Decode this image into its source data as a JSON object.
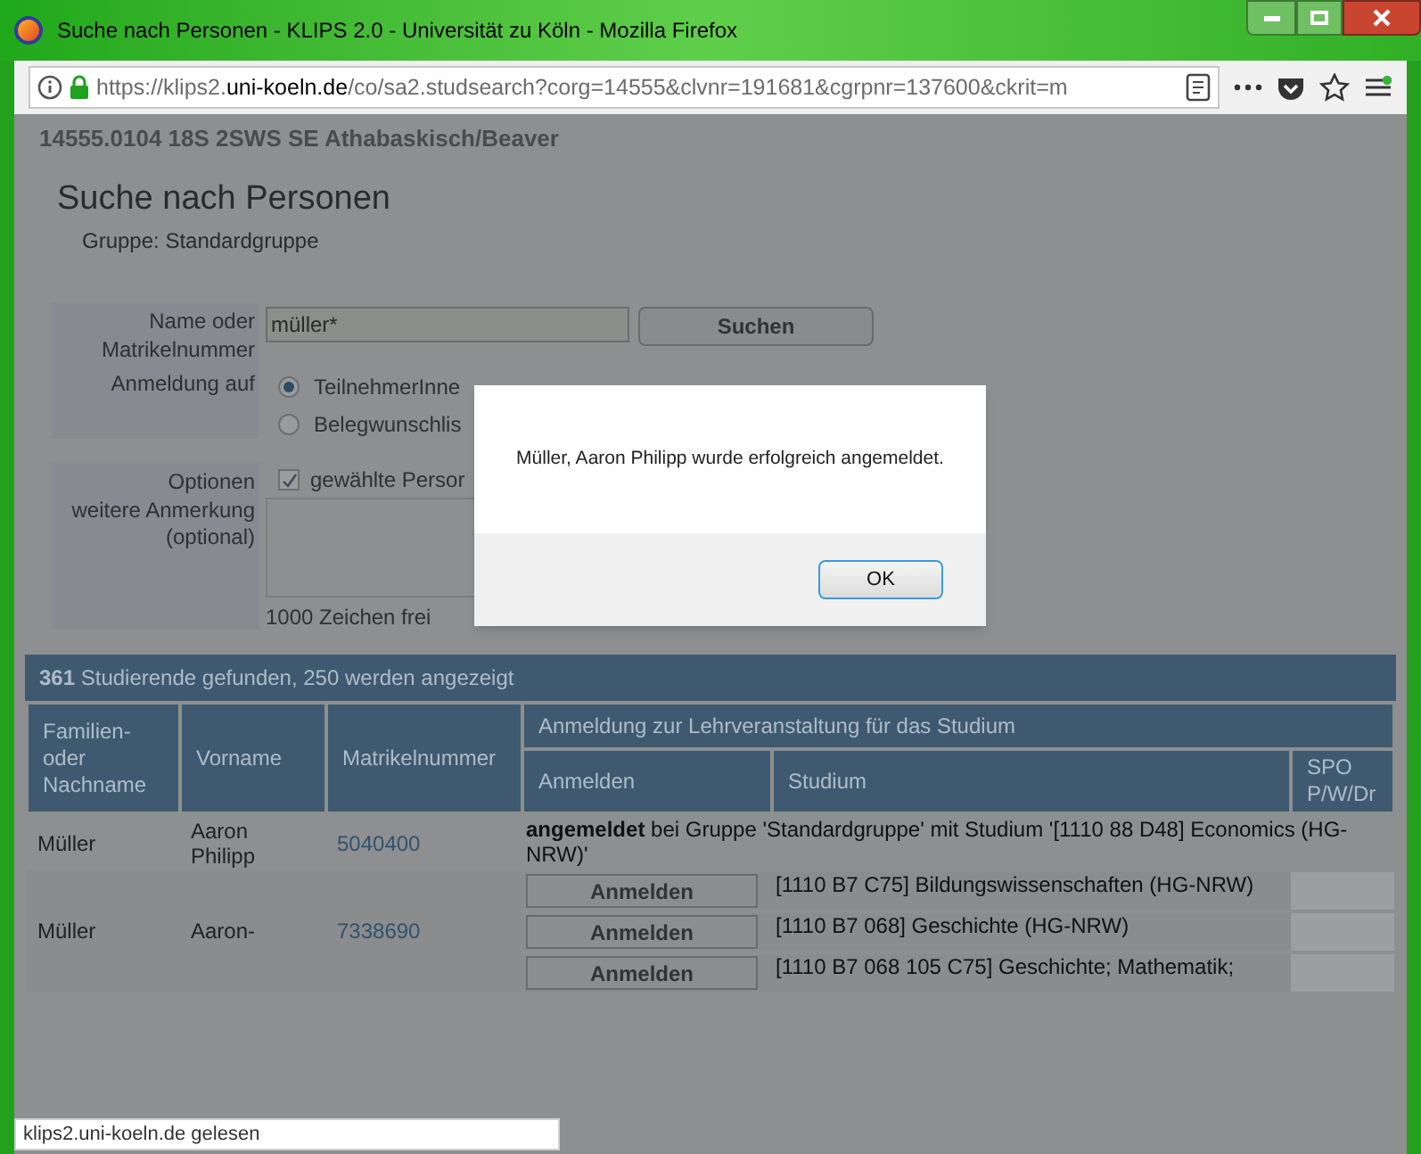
{
  "window": {
    "title": "Suche nach Personen - KLIPS 2.0 - Universität zu Köln - Mozilla Firefox"
  },
  "address_bar": {
    "url": "https://klips2.**uni-koeln.de**/co/sa2.studsearch?corg=14555&clvnr=191681&cgrpnr=137600&ckrit=m"
  },
  "page": {
    "course": "14555.0104 18S 2SWS SE Athabaskisch/Beaver",
    "heading": "Suche nach Personen",
    "group": "Gruppe: Standardgruppe",
    "form": {
      "name_label": "Name oder Matrikelnummer",
      "name_value": "müller*",
      "search_button": "Suchen",
      "anmeldung_label": "Anmeldung auf",
      "radios": [
        {
          "label": "TeilnehmerInne",
          "selected": true
        },
        {
          "label": "Belegwunschlis",
          "selected": false
        }
      ],
      "optionen_label": "Optionen",
      "option": {
        "label": "gewählte Persor",
        "checked": true
      },
      "anmerkung_label": "weitere Anmerkung (optional)",
      "chars_free": "1000 Zeichen frei"
    },
    "results": {
      "summary": "**361** Studierende gefunden, 250 werden angezeigt",
      "columns": {
        "nachname": "Familien- oder Nachname",
        "vorname": "Vorname",
        "matrikel": "Matrikelnummer",
        "group": "Anmeldung zur Lehrveranstaltung für das Studium",
        "anmelden": "Anmelden",
        "studium": "Studium",
        "spo": "SPO P/W/Dr"
      },
      "rows": [
        {
          "nachname": "Müller",
          "vorname": "Aaron Philipp",
          "matrikel": "5040400",
          "entries": [
            {
              "kind": "status",
              "text": "**angemeldet** bei Gruppe 'Standardgruppe' mit Studium '[1110 88 D48] Economics (HG-NRW)'"
            }
          ]
        },
        {
          "nachname": "Müller",
          "vorname": "Aaron-",
          "matrikel": "7338690",
          "entries": [
            {
              "kind": "option",
              "button": "Anmelden",
              "studium": "[1110 B7 C75] Bildungswissenschaften (HG-NRW)"
            },
            {
              "kind": "option",
              "button": "Anmelden",
              "studium": "[1110 B7 068] Geschichte (HG-NRW)"
            },
            {
              "kind": "option",
              "button": "Anmelden",
              "studium": "[1110 B7 068 105 C75] Geschichte; Mathematik;"
            }
          ]
        }
      ]
    }
  },
  "dialog": {
    "message": "Müller, Aaron Philipp wurde erfolgreich angemeldet.",
    "ok": "OK"
  },
  "status_bar": {
    "text": "klips2.uni-koeln.de gelesen"
  }
}
